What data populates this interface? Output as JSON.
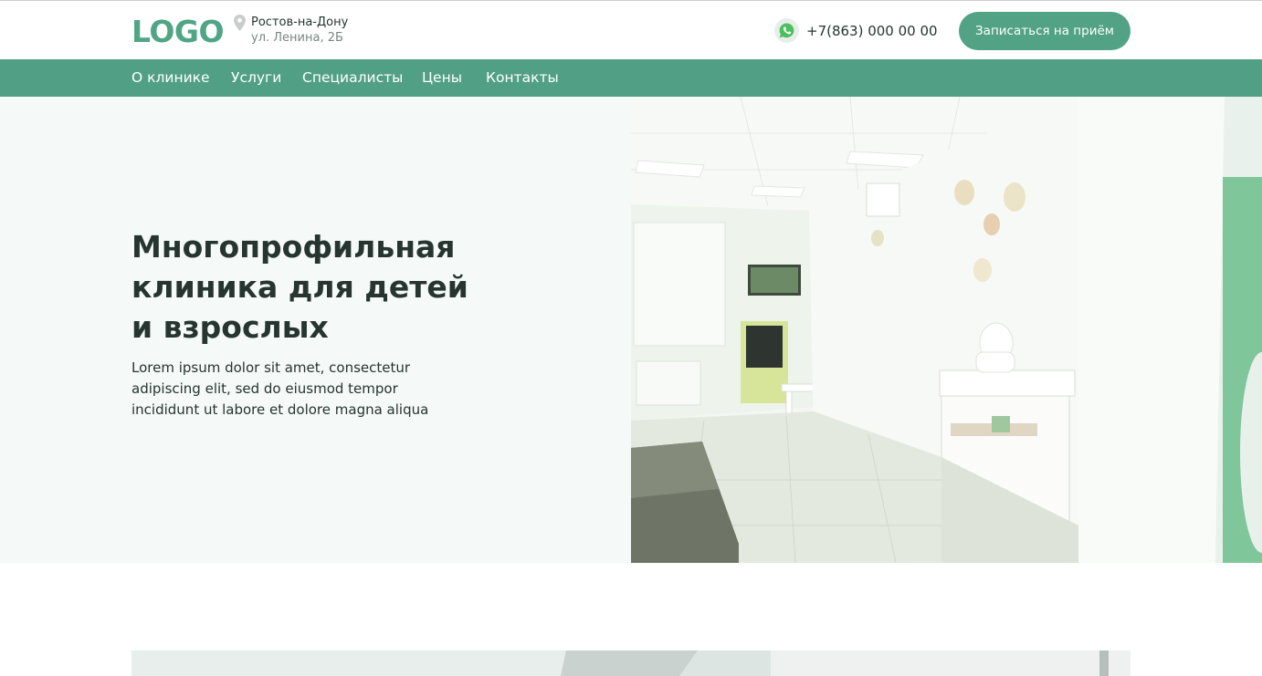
{
  "header": {
    "logo": "LOGO",
    "city": "Ростов-на-Дону",
    "street": "ул. Ленина, 2Б",
    "phone": "+7(863) 000 00 00",
    "book_label": "Записаться на приём",
    "icons": {
      "location": "map-pin-icon",
      "phone": "whatsapp-icon"
    }
  },
  "nav": {
    "items": [
      {
        "label": "О клинике"
      },
      {
        "label": "Услуги"
      },
      {
        "label": "Специалисты"
      },
      {
        "label": "Цены"
      },
      {
        "label": "Контакты"
      }
    ]
  },
  "hero": {
    "title_lines": [
      "Многопрофильная",
      "клиника для детей",
      "и взрослых"
    ],
    "text_lines": [
      "Lorem ipsum dolor sit amet, consectetur",
      "adipiscing elit, sed do eiusmod tempor",
      "incididunt ut labore et dolore magna aliqua"
    ]
  },
  "colors": {
    "brand_green": "#51a085",
    "logo_green": "#4fa584",
    "hero_bg": "#f5f9f8",
    "text_dark": "#263530"
  }
}
